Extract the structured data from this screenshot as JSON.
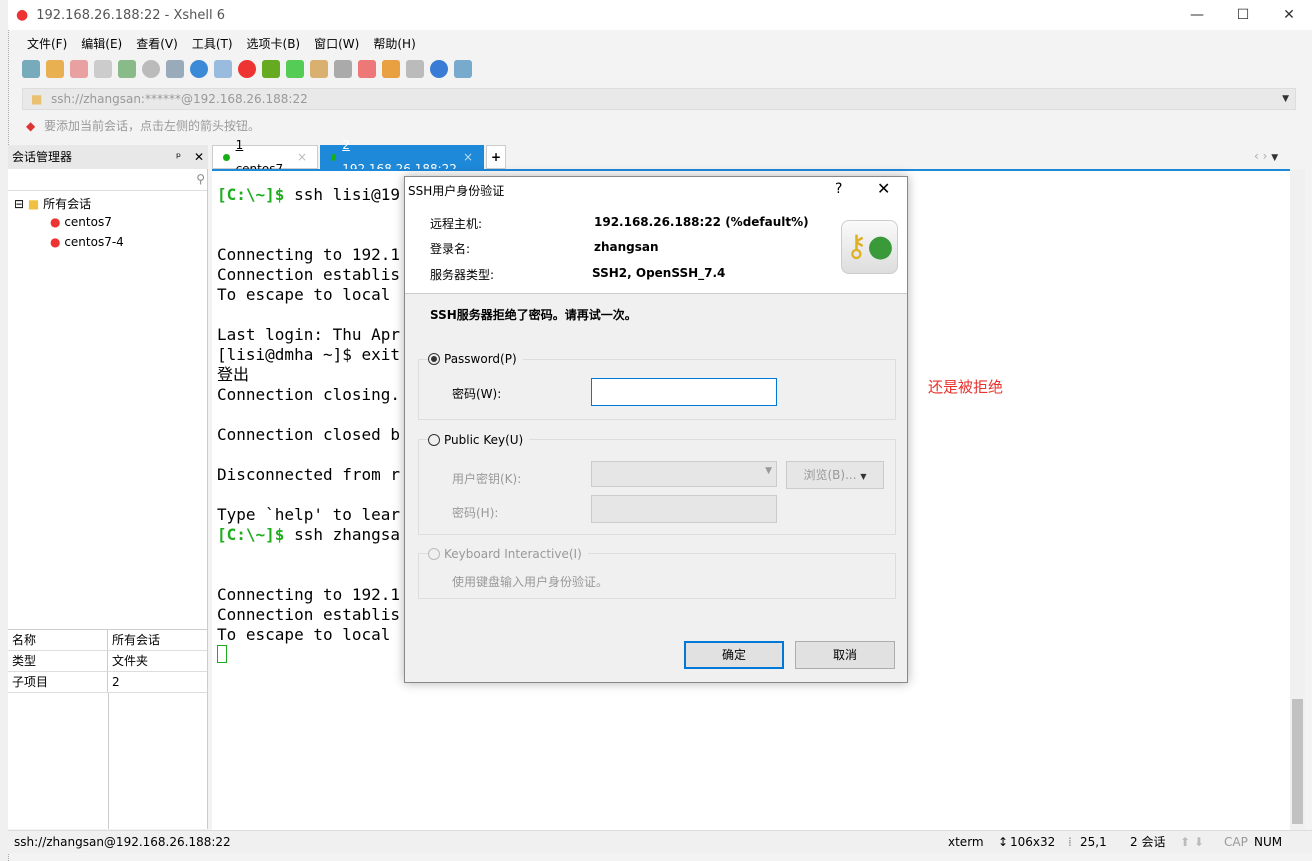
{
  "window": {
    "title": "192.168.26.188:22 - Xshell 6"
  },
  "menu": [
    "文件(F)",
    "编辑(E)",
    "查看(V)",
    "工具(T)",
    "选项卡(B)",
    "窗口(W)",
    "帮助(H)"
  ],
  "address": "ssh://zhangsan:******@192.168.26.188:22",
  "info": "要添加当前会话，点击左侧的箭头按钮。",
  "session_manager": {
    "title": "会话管理器",
    "root": "所有会话",
    "items": [
      "centos7",
      "centos7-4"
    ]
  },
  "properties": [
    [
      "名称",
      "所有会话"
    ],
    [
      "类型",
      "文件夹"
    ],
    [
      "子项目",
      "2"
    ]
  ],
  "tabs": [
    {
      "num": "1",
      "label": " centos7"
    },
    {
      "num": "2",
      "label": " 192.168.26.188:22"
    }
  ],
  "terminal": [
    [
      "[C:\\~]$",
      " ssh lisi@19"
    ],
    [
      "",
      ""
    ],
    [
      "",
      ""
    ],
    [
      "",
      "Connecting to 192.1"
    ],
    [
      "",
      "Connection establis"
    ],
    [
      "",
      "To escape to local"
    ],
    [
      "",
      ""
    ],
    [
      "",
      "Last login: Thu Apr"
    ],
    [
      "",
      "[lisi@dmha ~]$ exit"
    ],
    [
      "",
      "登出"
    ],
    [
      "",
      "Connection closing."
    ],
    [
      "",
      ""
    ],
    [
      "",
      "Connection closed b"
    ],
    [
      "",
      ""
    ],
    [
      "",
      "Disconnected from r"
    ],
    [
      "",
      ""
    ],
    [
      "",
      "Type `help' to lear"
    ],
    [
      "[C:\\~]$",
      " ssh zhangsa"
    ],
    [
      "",
      ""
    ],
    [
      "",
      ""
    ],
    [
      "",
      "Connecting to 192.1"
    ],
    [
      "",
      "Connection establis"
    ],
    [
      "",
      "To escape to local"
    ]
  ],
  "status": {
    "left": "ssh://zhangsan@192.168.26.188:22",
    "term": "xterm",
    "size": "106x32",
    "pos": "25,1",
    "sessions": "2 会话",
    "cap": "CAP",
    "num": "NUM"
  },
  "dialog": {
    "title": "SSH用户身份验证",
    "help": "?",
    "labels": [
      "远程主机:",
      "登录名:",
      "服务器类型:"
    ],
    "values": [
      "192.168.26.188:22 (%default%)",
      "zhangsan",
      "SSH2, OpenSSH_7.4"
    ],
    "message": "SSH服务器拒绝了密码。请再试一次。",
    "password": {
      "label": "Password(P)",
      "field": "密码(W):",
      "value": ""
    },
    "pubkey": {
      "label": "Public Key(U)",
      "key": "用户密钥(K):",
      "pass": "密码(H):",
      "browse": "浏览(B)..."
    },
    "keyboard": {
      "label": "Keyboard Interactive(I)",
      "desc": "使用键盘输入用户身份验证。"
    },
    "ok": "确定",
    "cancel": "取消"
  },
  "annotation": {
    "text": "还是被拒绝",
    "color": "#e8322b"
  }
}
